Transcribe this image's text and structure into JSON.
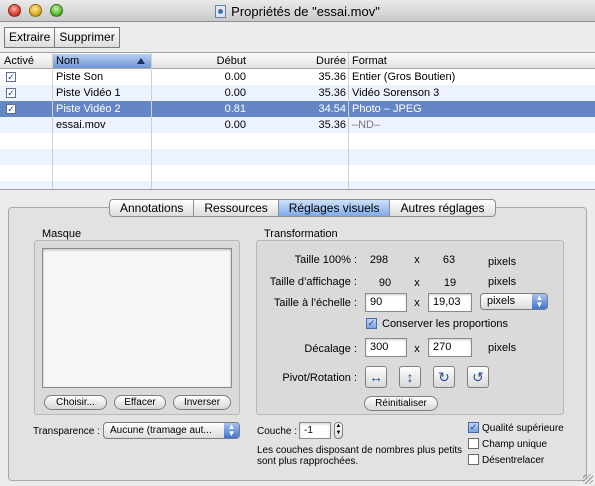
{
  "window": {
    "title": "Propriétés de \"essai.mov\""
  },
  "toolbar": {
    "extract_label": "Extraire",
    "delete_label": "Supprimer"
  },
  "table": {
    "columns": {
      "active": "Activé",
      "name": "Nom",
      "start": "Début",
      "duration": "Durée",
      "format": "Format"
    },
    "rows": [
      {
        "active": true,
        "name": "Piste Son",
        "start": "0.00",
        "duration": "35.36",
        "format": "Entier (Gros Boutien)"
      },
      {
        "active": true,
        "name": "Piste Vidéo 1",
        "start": "0.00",
        "duration": "35.36",
        "format": "Vidéo Sorenson 3"
      },
      {
        "active": true,
        "name": "Piste Vidéo 2",
        "start": "0.81",
        "duration": "34.54",
        "format": "Photo – JPEG"
      },
      {
        "active": false,
        "name": "essai.mov",
        "start": "0.00",
        "duration": "35.36",
        "format": "–ND–"
      }
    ],
    "selected_row": 2
  },
  "tabs": [
    "Annotations",
    "Ressources",
    "Réglages visuels",
    "Autres réglages"
  ],
  "active_tab": "Réglages visuels",
  "mask": {
    "title": "Masque",
    "choose_label": "Choisir...",
    "clear_label": "Effacer",
    "invert_label": "Inverser"
  },
  "transform": {
    "title": "Transformation",
    "size100_label": "Taille 100% :",
    "size100_w": "298",
    "size100_h": "63",
    "display_label": "Taille d’affichage :",
    "display_w": "90",
    "display_h": "19",
    "scale_label": "Taille à l’échelle :",
    "scale_w": "90",
    "scale_h": "19,03",
    "times": "x",
    "pixels": "pixels",
    "unit_popup": "pixels",
    "keep_ratio_label": "Conserver les proportions",
    "keep_ratio": true,
    "offset_label": "Décalage :",
    "offset_x": "300",
    "offset_y": "270",
    "pivot_label": "Pivot/Rotation :",
    "reset_label": "Réinitialiser"
  },
  "bottom": {
    "transparency_label": "Transparence :",
    "transparency_value": "Aucune (tramage aut...",
    "layer_label": "Couche :",
    "layer_value": "-1",
    "layer_help": "Les couches disposant de nombres plus petits sont plus rapprochées.",
    "hq_label": "Qualité supérieure",
    "hq": true,
    "single_field_label": "Champ unique",
    "single_field": false,
    "deinterlace_label": "Désentrelacer",
    "deinterlace": false
  }
}
